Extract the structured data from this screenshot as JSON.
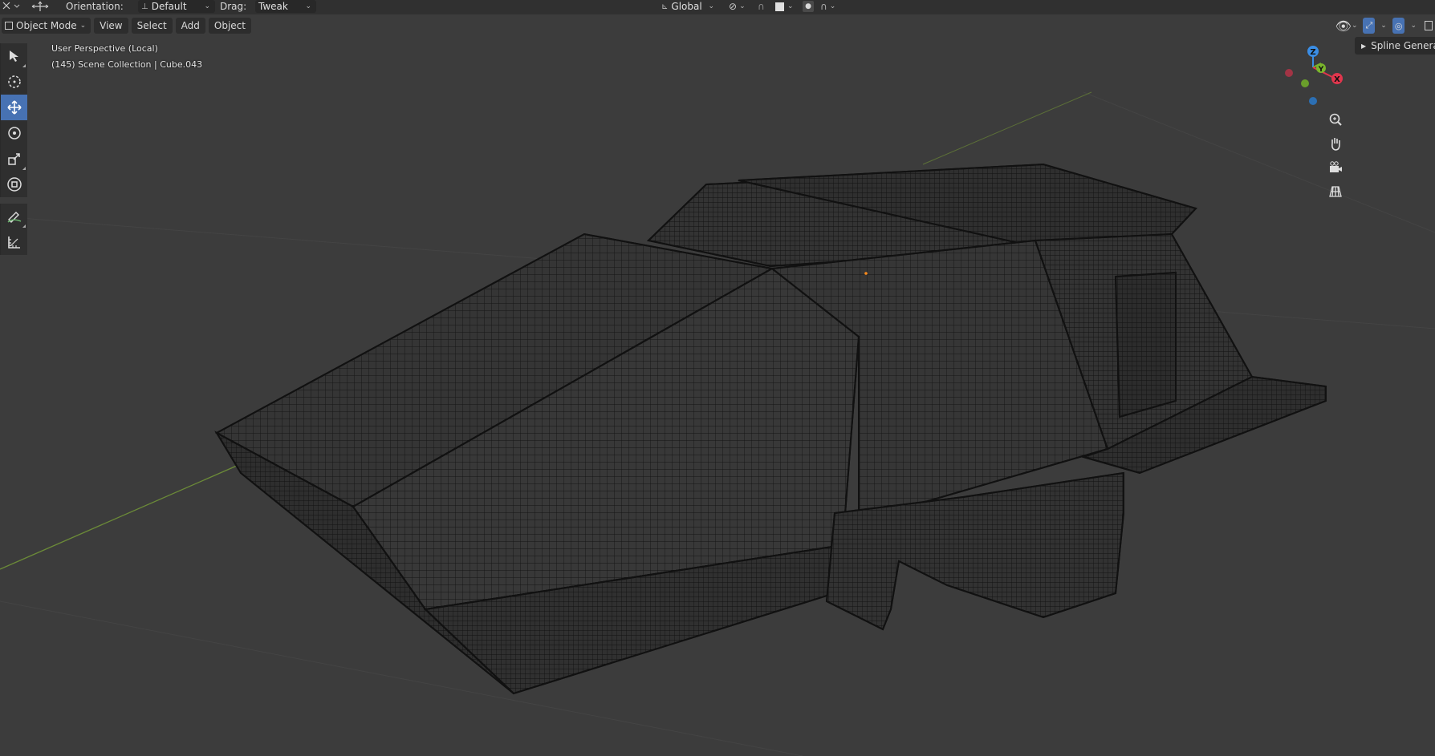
{
  "toolheader": {
    "orientation_label": "Orientation:",
    "orientation_value": "Default",
    "drag_label": "Drag:",
    "drag_value": "Tweak",
    "transform_orientation": "Global"
  },
  "header": {
    "mode": "Object Mode",
    "menus": [
      "View",
      "Select",
      "Add",
      "Object"
    ]
  },
  "overlay": {
    "perspective": "User Perspective (Local)",
    "collection": "(145) Scene Collection | Cube.043"
  },
  "gizmo": {
    "z_label": "Z",
    "y_label": "Y",
    "x_label": "X",
    "colors": {
      "x": "#e0364d",
      "y": "#7ab52c",
      "z": "#3a8ee6"
    }
  },
  "sidebar_tab": {
    "label": "Spline Genera"
  },
  "toolbar": {
    "tools": [
      "cursor-tool",
      "cursor-3d-tool",
      "move-tool",
      "rotate-tool",
      "scale-tool",
      "transform-tool",
      "annotate-tool",
      "measure-tool"
    ],
    "active": "move-tool"
  },
  "colors": {
    "accent": "#4772b3",
    "background": "#3c3c3c",
    "mesh": "#2a2a2a",
    "wire": "#1a1a1a"
  }
}
